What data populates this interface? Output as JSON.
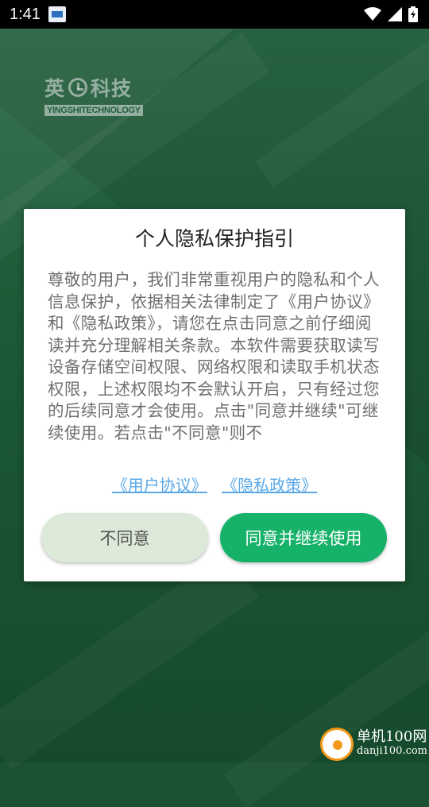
{
  "status_bar": {
    "time": "1:41",
    "icons": [
      "notification-icon",
      "wifi-icon",
      "signal-icon",
      "battery-icon"
    ]
  },
  "logo": {
    "chinese_text": "英科技",
    "english_text": "YINGSHITECHNOLOGY"
  },
  "dialog": {
    "title": "个人隐私保护指引",
    "body": "尊敬的用户，我们非常重视用户的隐私和个人信息保护，依据相关法律制定了《用户协议》和《隐私政策》，请您在点击同意之前仔细阅读并充分理解相关条款。本软件需要获取读写设备存储空间权限、网络权限和读取手机状态权限，上述权限均不会默认开启，只有经过您的后续同意才会使用。点击\"同意并继续\"可继续使用。若点击\"不同意\"则不",
    "link_user_agreement": "《用户协议》",
    "link_privacy_policy": "《隐私政策》",
    "disagree_label": "不同意",
    "agree_label": "同意并继续使用"
  },
  "watermark": {
    "site_name": "单机100网",
    "site_url": "danji100.com"
  },
  "colors": {
    "background": "#1a5232",
    "agree_button": "#17b26a",
    "disagree_button": "#dde9d9",
    "link": "#5aa8e8"
  }
}
